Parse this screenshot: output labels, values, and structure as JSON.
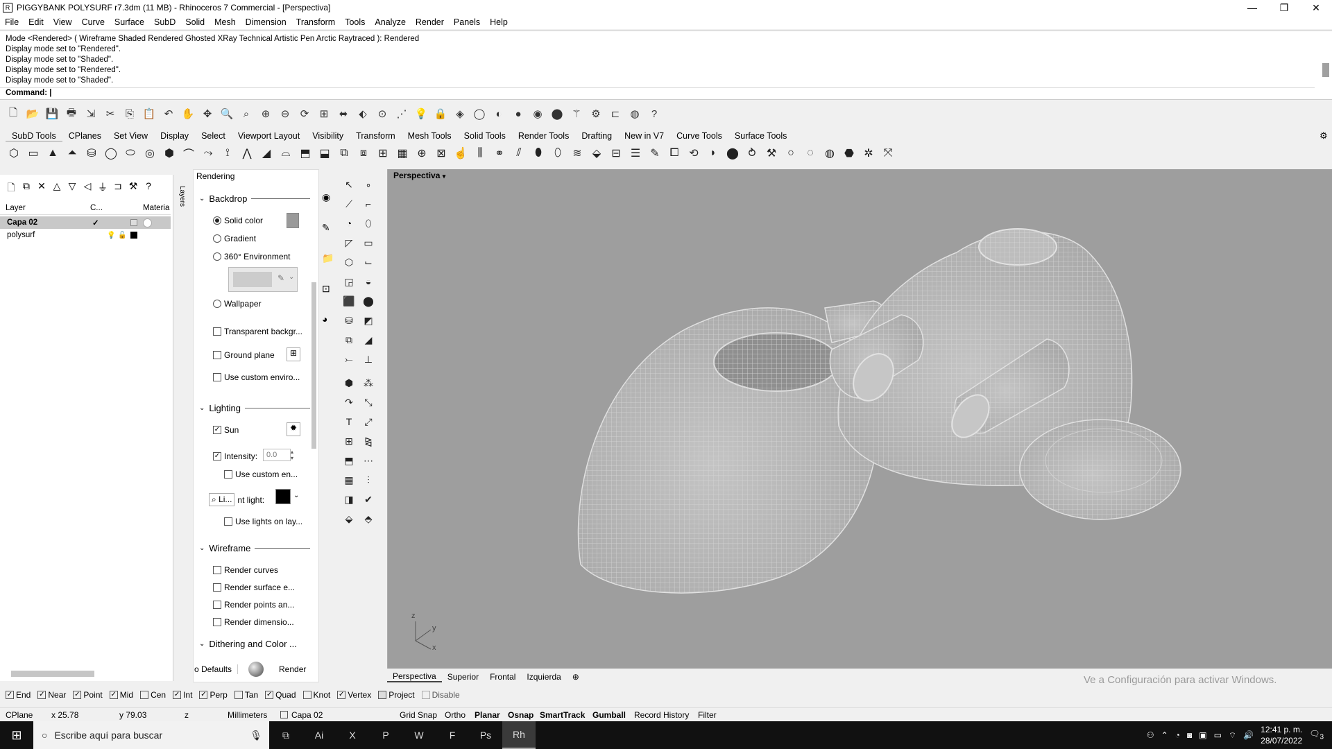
{
  "window": {
    "title": "PIGGYBANK POLYSURF r7.3dm (11 MB) - Rhinoceros 7 Commercial - [Perspectiva]",
    "app_icon_name": "rhino-icon",
    "minimize_glyph": "—",
    "restore_glyph": "❐",
    "close_glyph": "✕"
  },
  "menu": [
    "File",
    "Edit",
    "View",
    "Curve",
    "Surface",
    "SubD",
    "Solid",
    "Mesh",
    "Dimension",
    "Transform",
    "Tools",
    "Analyze",
    "Render",
    "Panels",
    "Help"
  ],
  "command_history": {
    "lines": [
      "Mode <Rendered> ( Wireframe  Shaded  Rendered  Ghosted  XRay  Technical  Artistic  Pen  Arctic  Raytraced ): Rendered",
      "Display mode set to \"Rendered\".",
      "Display mode set to \"Shaded\".",
      "Display mode set to \"Rendered\".",
      "Display mode set to \"Shaded\"."
    ],
    "prompt": "Command:"
  },
  "toolbar_tabs": [
    "SubD Tools",
    "CPlanes",
    "Set View",
    "Display",
    "Select",
    "Viewport Layout",
    "Visibility",
    "Transform",
    "Mesh Tools",
    "Solid Tools",
    "Render Tools",
    "Drafting",
    "New in V7",
    "Curve Tools",
    "Surface Tools"
  ],
  "layers": {
    "headers": [
      "Layer",
      "C...",
      "Materia"
    ],
    "rows": [
      {
        "name": "Capa 02",
        "current": "✓",
        "selected": true
      },
      {
        "name": "polysurf",
        "current": "",
        "selected": false
      }
    ],
    "side_tab": "Layers"
  },
  "rendering_panel": {
    "title": "Rendering",
    "backdrop": {
      "heading": "Backdrop",
      "options": [
        "Solid color",
        "Gradient",
        "360° Environment",
        "Wallpaper"
      ],
      "selected": "Solid color",
      "checks": [
        "Transparent backgr...",
        "Ground plane",
        "Use custom enviro..."
      ]
    },
    "lighting": {
      "heading": "Lighting",
      "sun_label": "Sun",
      "intensity_label": "Intensity:",
      "intensity_value": "0.0",
      "use_custom": "Use custom en...",
      "ambient_prefix": "Li...",
      "ambient_label": "nt light:",
      "use_lights": "Use lights on lay..."
    },
    "wireframe": {
      "heading": "Wireframe",
      "checks": [
        "Render curves",
        "Render surface e...",
        "Render points an...",
        "Render dimensio..."
      ]
    },
    "dithering_heading": "Dithering and Color ...",
    "defaults_btn": "o Defaults",
    "render_btn": "Render"
  },
  "viewport": {
    "label": "Perspectiva",
    "tabs": [
      "Perspectiva",
      "Superior",
      "Frontal",
      "Izquierda"
    ],
    "watermark": "Ve a Configuración para activar Windows.",
    "axis": {
      "z": "z",
      "y": "y",
      "x": "x"
    }
  },
  "osnap": [
    {
      "label": "End",
      "checked": true
    },
    {
      "label": "Near",
      "checked": true
    },
    {
      "label": "Point",
      "checked": true
    },
    {
      "label": "Mid",
      "checked": true
    },
    {
      "label": "Cen",
      "checked": false
    },
    {
      "label": "Int",
      "checked": true
    },
    {
      "label": "Perp",
      "checked": true
    },
    {
      "label": "Tan",
      "checked": false
    },
    {
      "label": "Quad",
      "checked": true
    },
    {
      "label": "Knot",
      "checked": false
    },
    {
      "label": "Vertex",
      "checked": true
    },
    {
      "label": "Project",
      "checked": false
    },
    {
      "label": "Disable",
      "checked": false
    }
  ],
  "status": {
    "cplane": "CPlane",
    "x": "x 25.78",
    "y": "y 79.03",
    "z": "z",
    "units": "Millimeters",
    "layer": "Capa 02",
    "toggles": [
      "Grid Snap",
      "Ortho",
      "Planar",
      "Osnap",
      "SmartTrack",
      "Gumball",
      "Record History",
      "Filter"
    ],
    "active_toggles": [
      "Planar",
      "Osnap",
      "SmartTrack",
      "Gumball"
    ]
  },
  "taskbar": {
    "search_placeholder": "Escribe aquí para buscar",
    "apps": [
      "Ai",
      "X",
      "P",
      "W",
      "F",
      "Ps",
      "Rh"
    ],
    "time": "12:41 p. m.",
    "date": "28/07/2022",
    "notification_count": "3"
  }
}
